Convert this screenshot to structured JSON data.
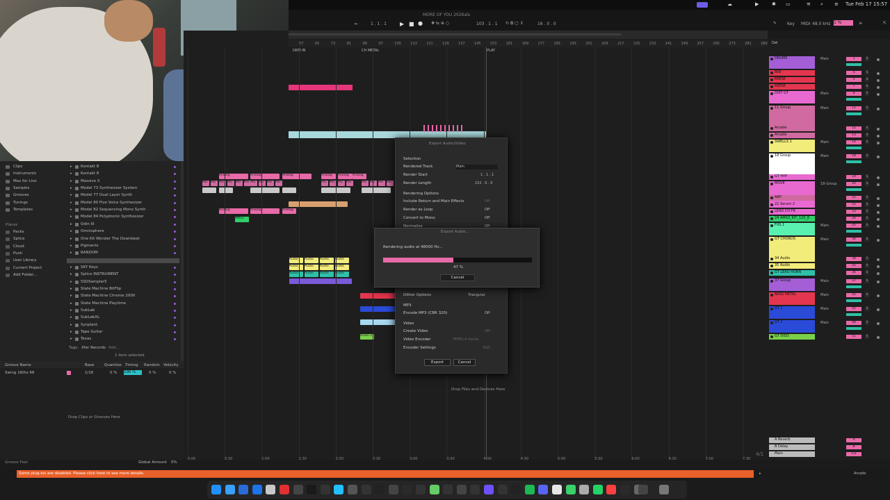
{
  "menubar": {
    "app_title": "MORE OF YOU 2026als",
    "datetime": "Tue Feb 17  15:57"
  },
  "transport": {
    "position": "1 . 1 . 1",
    "tempo": "103 . 1 . 1",
    "loop_len": "16 . 0 . 0",
    "key_label": "Key",
    "midi_label": "MIDI",
    "sample_rate": "48.0 kHz",
    "cpu": "1 %"
  },
  "ruler": {
    "bars": [
      "57",
      "65",
      "73",
      "81",
      "89",
      "97",
      "105",
      "113",
      "121",
      "129",
      "137",
      "145",
      "153",
      "161",
      "169",
      "177",
      "185",
      "193",
      "201",
      "209",
      "217",
      "225",
      "233",
      "241",
      "249",
      "257",
      "265",
      "273",
      "281",
      "289"
    ],
    "locators": [
      "DRM IN",
      "CH METAL",
      "PLAY"
    ],
    "times": [
      "0:00",
      "0:30",
      "1:00",
      "1:30",
      "2:00",
      "2:30",
      "3:00",
      "3:30",
      "4:00",
      "4:30",
      "5:00",
      "5:30",
      "6:00",
      "6:30",
      "7:00",
      "7:30"
    ],
    "signature": "4/1"
  },
  "browser": {
    "places_header": "Places",
    "collections": [
      "Clips",
      "Instruments",
      "Max for Live",
      "Samples",
      "Grooves",
      "Tunings",
      "Templates"
    ],
    "places": [
      "Packs",
      "Splice",
      "Cloud",
      "Push",
      "User Library",
      "Current Project",
      "Add Folder..."
    ],
    "items": [
      "Kontakt 8",
      "Kontakt 8",
      "Massive X",
      "Model 73 Synthesizer System",
      "Model 77 Dual Layer Synth",
      "Model 80 Five Voice Synthesizer",
      "Model 82 Sequencing Mono Synth",
      "Model 84 Polyphonic Synthesizer",
      "Odin III",
      "Omnisphere",
      "One Kit Wonder The Downbeat",
      "Pigments",
      "RANDOM",
      "Serum 2",
      "SKY Keys",
      "Splice INSTRUMENT",
      "SSDSampler5",
      "State Machine BitFlip",
      "State Machine Chrome 2000",
      "State Machine Playtime",
      "SubLab",
      "SubLabXL",
      "Synplant",
      "Tape Guitar",
      "Texas"
    ],
    "tags_label": "Tags:",
    "tag": "Xfer Records",
    "tag_add": "Add...",
    "selected_info": "1 item selected"
  },
  "groove": {
    "headers": [
      "Groove Name",
      "Base",
      "Quantize",
      "Timing",
      "Random",
      "Velocity"
    ],
    "row": {
      "name": "Swing 16ths 66",
      "base": "1/16",
      "quantize": "0 %",
      "timing": "100 %",
      "random": "0 %",
      "velocity": "0 %"
    },
    "drop_text": "Drop Clips or Grooves Here",
    "pool_label": "Groove Pool",
    "global_amount_label": "Global Amount",
    "global_amount": "0%"
  },
  "arrange": {
    "drop_text": "Drop Files and Devices Here"
  },
  "export_dialog": {
    "title": "Export Audio/Video",
    "selection_header": "Selection",
    "rendered_track_label": "Rendered Track",
    "rendered_track": "Main",
    "render_start_label": "Render Start",
    "render_start": "1 . 1 . 1",
    "render_length_label": "Render Length",
    "render_length": "152 . 0 . 0",
    "options_header": "Rendering Options",
    "include_return_label": "Include Return and Main Effects",
    "include_return": "Off",
    "render_loop_label": "Render as Loop",
    "render_loop": "Off",
    "convert_mono_label": "Convert to Mono",
    "convert_mono": "Off",
    "normalize_label": "Normalize",
    "normalize": "Off",
    "dither_label": "Dither Options",
    "dither": "Triangular",
    "mp3_header": "MP3",
    "encode_mp3_label": "Encode MP3 (CBR 320)",
    "encode_mp3": "Off",
    "video_header": "Video",
    "create_video_label": "Create Video",
    "create_video": "Off",
    "video_encoder_label": "Video Encoder",
    "video_encoder": "MPEG-4 movie",
    "encoder_settings_label": "Encoder Settings",
    "encoder_settings": "Edit",
    "export_button": "Export",
    "cancel_button": "Cancel"
  },
  "progress_dialog": {
    "title": "Export Audio...",
    "message": "Rendering audio at 48000 Hz...",
    "percent_text": "47 %",
    "progress": 0.47,
    "cancel_button": "Cancel"
  },
  "mixer": {
    "tracks": [
      {
        "name": "DRUMS",
        "color": "#a45ed6",
        "out": "Main",
        "num": "1"
      },
      {
        "name": "808",
        "color": "#e5364f",
        "out": "",
        "num": "4"
      },
      {
        "name": "REESE",
        "color": "#e5364f",
        "out": "",
        "num": "5"
      },
      {
        "name": "REESE",
        "color": "#e5364f",
        "out": "",
        "num": "7"
      },
      {
        "name": "DIST GT",
        "color": "#e86ad0",
        "out": "Main",
        "num": "8"
      },
      {
        "name": "11 Group",
        "color": "#d06aa0",
        "out": "Main",
        "num": "11"
      },
      {
        "name": "Arcade",
        "color": "#d06aa0",
        "out": "",
        "num": "12"
      },
      {
        "name": "Arcade",
        "color": "#d06aa0",
        "out": "",
        "num": "13"
      },
      {
        "name": "SWELLS 1",
        "color": "#f2ec7a",
        "out": "Main",
        "num": "14"
      },
      {
        "name": "18 Group",
        "color": "#ffffff",
        "out": "Main",
        "num": "18"
      },
      {
        "name": "GT HYP",
        "color": "#e86ad0",
        "out": "",
        "num": "19"
      },
      {
        "name": "MOVE",
        "color": "#e86ad0",
        "out": "18-Group",
        "num": "20"
      },
      {
        "name": "ARP",
        "color": "#d06aa0",
        "out": "",
        "num": "21"
      },
      {
        "name": "22 Serum 2",
        "color": "#e86ad0",
        "out": "",
        "num": "22"
      },
      {
        "name": "LEAD CH FR",
        "color": "#e86ad0",
        "out": "",
        "num": "23"
      },
      {
        "name": "24 AMS3_KIT_120_8",
        "color": "#2ed06a",
        "out": "",
        "num": "24"
      },
      {
        "name": "FXS 1",
        "color": "#5af0b0",
        "out": "Main",
        "num": "25"
      },
      {
        "name": "GT CHORDS",
        "color": "#f2ec7a",
        "out": "Main",
        "num": "30"
      },
      {
        "name": "34 Audio",
        "color": "#f2ec7a",
        "out": "",
        "num": "34"
      },
      {
        "name": "35 Audio",
        "color": "#f2ec7a",
        "out": "",
        "num": "35"
      },
      {
        "name": "GT LEAD HORN",
        "color": "#2ec0a8",
        "out": "",
        "num": "36"
      },
      {
        "name": "37 Group",
        "color": "#a45ed6",
        "out": "Main",
        "num": "37"
      },
      {
        "name": "BASS METAL",
        "color": "#e5364f",
        "out": "Main",
        "num": "42"
      },
      {
        "name": "GT 1",
        "color": "#2a4ad8",
        "out": "Main",
        "num": "45"
      },
      {
        "name": "GT 2",
        "color": "#2a4ad8",
        "out": "Main",
        "num": "48"
      },
      {
        "name": "GT DISO",
        "color": "#7ad04a",
        "out": "",
        "num": "51"
      }
    ],
    "returns": [
      {
        "name": "A Reverb",
        "num": "A"
      },
      {
        "name": "B Delay",
        "num": "B"
      },
      {
        "name": "Main",
        "num": "1/2"
      }
    ],
    "del_label": "Del"
  },
  "status": {
    "warning": "Some plug-ins are disabled. Please click here to see more details.",
    "right_label": "Arcade"
  }
}
